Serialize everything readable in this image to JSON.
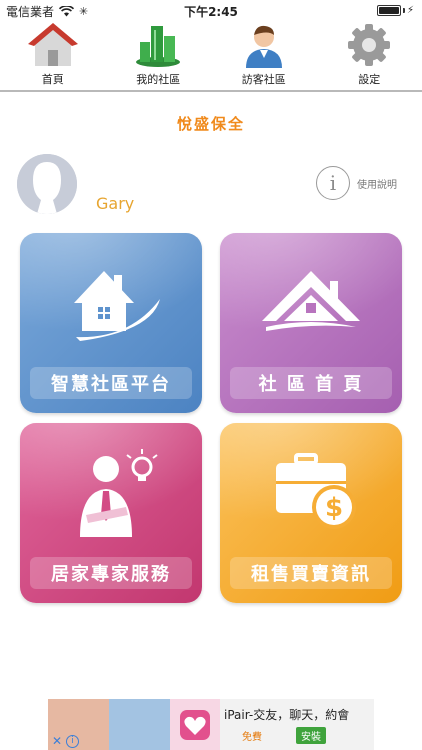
{
  "status_bar": {
    "carrier": "電信業者",
    "time": "下午2:45",
    "battery_level": 1.0
  },
  "tabs": [
    {
      "label": "首頁",
      "icon": "home-icon"
    },
    {
      "label": "我的社區",
      "icon": "buildings-icon"
    },
    {
      "label": "訪客社區",
      "icon": "person-icon"
    },
    {
      "label": "設定",
      "icon": "gear-icon"
    }
  ],
  "header": {
    "title": "悅盛保全",
    "title_color": "#f08a1c"
  },
  "user": {
    "name": "Gary",
    "help_label": "使用說明"
  },
  "tiles": [
    {
      "label": "智慧社區平台",
      "icon": "house-swoosh-icon",
      "color": "#5f93cd"
    },
    {
      "label": "社 區 首 頁",
      "icon": "house-roof-icon",
      "color": "#b874be"
    },
    {
      "label": "居家專家服務",
      "icon": "expert-idea-icon",
      "color": "#d34b85"
    },
    {
      "label": "租售買賣資訊",
      "icon": "briefcase-dollar-icon",
      "color": "#f6ad35"
    }
  ],
  "ad": {
    "app_name": "iPair-交友，聊天，約會",
    "price": "免費",
    "install_label": "安裝"
  }
}
